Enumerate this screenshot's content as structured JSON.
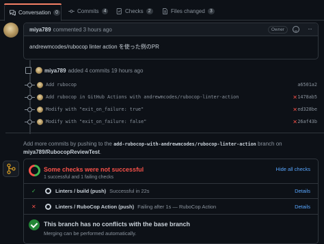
{
  "tabs": [
    {
      "label": "Conversation",
      "count": "0"
    },
    {
      "label": "Commits",
      "count": "4"
    },
    {
      "label": "Checks",
      "count": "2"
    },
    {
      "label": "Files changed",
      "count": "3"
    }
  ],
  "comment": {
    "author": "miya789",
    "action": "commented 3 hours ago",
    "badge": "Owner",
    "body": "andrewmcodes/rubocop linter action を使った例のPR"
  },
  "timeline": {
    "author": "miya789",
    "action": "added 4 commits 19 hours ago",
    "commits": [
      {
        "message": "Add rubocop",
        "status": "",
        "sha": "a6501a2"
      },
      {
        "message": "Add rubocop in GitHub Actions with andrewmcodes/rubocop-linter-action",
        "status": "✕",
        "sha": "1478ab5"
      },
      {
        "message": "Modify with \"exit_on_failure: true\"",
        "status": "✕",
        "sha": "ed328be"
      },
      {
        "message": "Modify with \"exit_on_failure: false\"",
        "status": "✕",
        "sha": "26af43b"
      }
    ]
  },
  "push_info": {
    "prefix": "Add more commits by pushing to the",
    "branch_code": "add-rubocop-with-andrewmcodes/rubocop-linter-action",
    "middle": "branch on",
    "repo": "miya789/RubocopReviewTest",
    "suffix": "."
  },
  "checks": {
    "title": "Some checks were not successful",
    "subtitle": "1 successful and 1 failing checks",
    "hide_label": "Hide all checks",
    "items": [
      {
        "status": "✓",
        "status_color": "#3fb950",
        "name": "Linters / build (push)",
        "desc": "Successful in 22s",
        "details": "Details"
      },
      {
        "status": "✕",
        "status_color": "#f85149",
        "name": "Linters / RuboCop Action (push)",
        "desc": "Failing after 1s — RuboCop Action",
        "details": "Details"
      }
    ]
  },
  "merge": {
    "title": "This branch has no conflicts with the base branch",
    "subtitle": "Merging can be performed automatically."
  },
  "colors": {
    "accent": "#f78166",
    "success": "#3fb950",
    "danger": "#f85149",
    "link": "#58a6ff"
  }
}
